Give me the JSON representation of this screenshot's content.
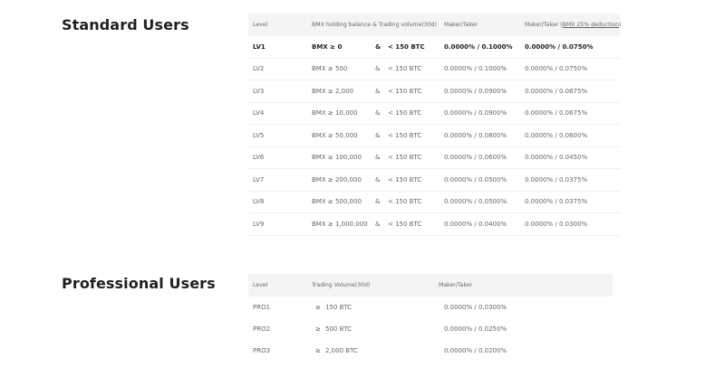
{
  "standard": {
    "title": "Standard Users",
    "headers": {
      "level": "Level",
      "balance_volume": "BMX holding balance & Trading volume(30d)",
      "maker_taker": "Maker/Taker",
      "maker_taker_deduction_prefix": "Maker/Taker (",
      "maker_taker_deduction_link": "BMX 25% deduction",
      "maker_taker_deduction_suffix": ")"
    },
    "rows": [
      {
        "level": "LV1",
        "balance": "BMX ≥ 0",
        "amp": "&",
        "volume": "< 150 BTC",
        "maker_taker": "0.0000% / 0.1000%",
        "maker_taker_deduction": "0.0000% / 0.0750%"
      },
      {
        "level": "LV2",
        "balance": "BMX ≥ 500",
        "amp": "&",
        "volume": "< 150 BTC",
        "maker_taker": "0.0000% / 0.1000%",
        "maker_taker_deduction": "0.0000% / 0.0750%"
      },
      {
        "level": "LV3",
        "balance": "BMX ≥ 2,000",
        "amp": "&",
        "volume": "< 150 BTC",
        "maker_taker": "0.0000% / 0.0900%",
        "maker_taker_deduction": "0.0000% / 0.0675%"
      },
      {
        "level": "LV4",
        "balance": "BMX ≥ 10,000",
        "amp": "&",
        "volume": "< 150 BTC",
        "maker_taker": "0.0000% / 0.0900%",
        "maker_taker_deduction": "0.0000% / 0.0675%"
      },
      {
        "level": "LV5",
        "balance": "BMX ≥ 50,000",
        "amp": "&",
        "volume": "< 150 BTC",
        "maker_taker": "0.0000% / 0.0800%",
        "maker_taker_deduction": "0.0000% / 0.0600%"
      },
      {
        "level": "LV6",
        "balance": "BMX ≥ 100,000",
        "amp": "&",
        "volume": "< 150 BTC",
        "maker_taker": "0.0000% / 0.0600%",
        "maker_taker_deduction": "0.0000% / 0.0450%"
      },
      {
        "level": "LV7",
        "balance": "BMX ≥ 200,000",
        "amp": "&",
        "volume": "< 150 BTC",
        "maker_taker": "0.0000% / 0.0500%",
        "maker_taker_deduction": "0.0000% / 0.0375%"
      },
      {
        "level": "LV8",
        "balance": "BMX ≥ 500,000",
        "amp": "&",
        "volume": "< 150 BTC",
        "maker_taker": "0.0000% / 0.0500%",
        "maker_taker_deduction": "0.0000% / 0.0375%"
      },
      {
        "level": "LV9",
        "balance": "BMX ≥ 1,000,000",
        "amp": "&",
        "volume": "< 150 BTC",
        "maker_taker": "0.0000% / 0.0400%",
        "maker_taker_deduction": "0.0000% / 0.0300%"
      }
    ]
  },
  "professional": {
    "title": "Professional Users",
    "headers": {
      "level": "Level",
      "volume": "Trading Volume(30d)",
      "maker_taker": "Maker/Taker"
    },
    "rows": [
      {
        "level": "PRO1",
        "ge": "≥",
        "volume": "150 BTC",
        "maker_taker": "0.0000% / 0.0300%"
      },
      {
        "level": "PRO2",
        "ge": "≥",
        "volume": "500 BTC",
        "maker_taker": "0.0000% / 0.0250%"
      },
      {
        "level": "PRO3",
        "ge": "≥",
        "volume": "2,000 BTC",
        "maker_taker": "0.0000% / 0.0200%"
      }
    ]
  }
}
